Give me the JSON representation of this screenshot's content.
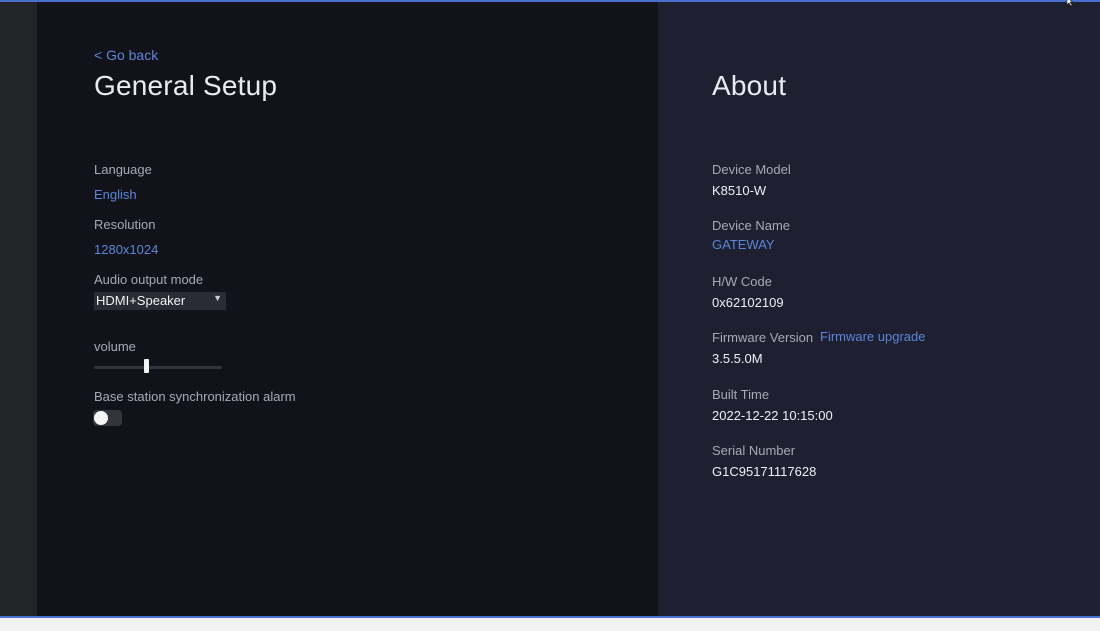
{
  "general": {
    "go_back": "< Go back",
    "title": "General Setup",
    "language": {
      "label": "Language",
      "value": "English"
    },
    "resolution": {
      "label": "Resolution",
      "value": "1280x1024"
    },
    "audio_output": {
      "label": "Audio output mode",
      "value": "HDMI+Speaker"
    },
    "volume": {
      "label": "volume",
      "level": 0.41
    },
    "sync_alarm": {
      "label": "Base station synchronization alarm",
      "enabled": false
    }
  },
  "about": {
    "title": "About",
    "device_model": {
      "label": "Device Model",
      "value": "K8510-W"
    },
    "device_name": {
      "label": "Device Name",
      "value": "GATEWAY"
    },
    "hw_code": {
      "label": "H/W Code",
      "value": "0x62102109"
    },
    "firmware": {
      "label": "Firmware Version",
      "value": "3.5.5.0M",
      "upgrade_link": "Firmware upgrade"
    },
    "built_time": {
      "label": "Built Time",
      "value": "2022-12-22 10:15:00"
    },
    "serial": {
      "label": "Serial Number",
      "value": "G1C95171117628"
    }
  },
  "colors": {
    "accent": "#5b86d9",
    "left_panel_bg": "#12131a",
    "right_panel_bg": "#1e2031",
    "frame_line": "#4a6fd0"
  },
  "icons": {
    "select_chevron": "chevron-down-icon",
    "pointer": "mouse-pointer-icon"
  }
}
